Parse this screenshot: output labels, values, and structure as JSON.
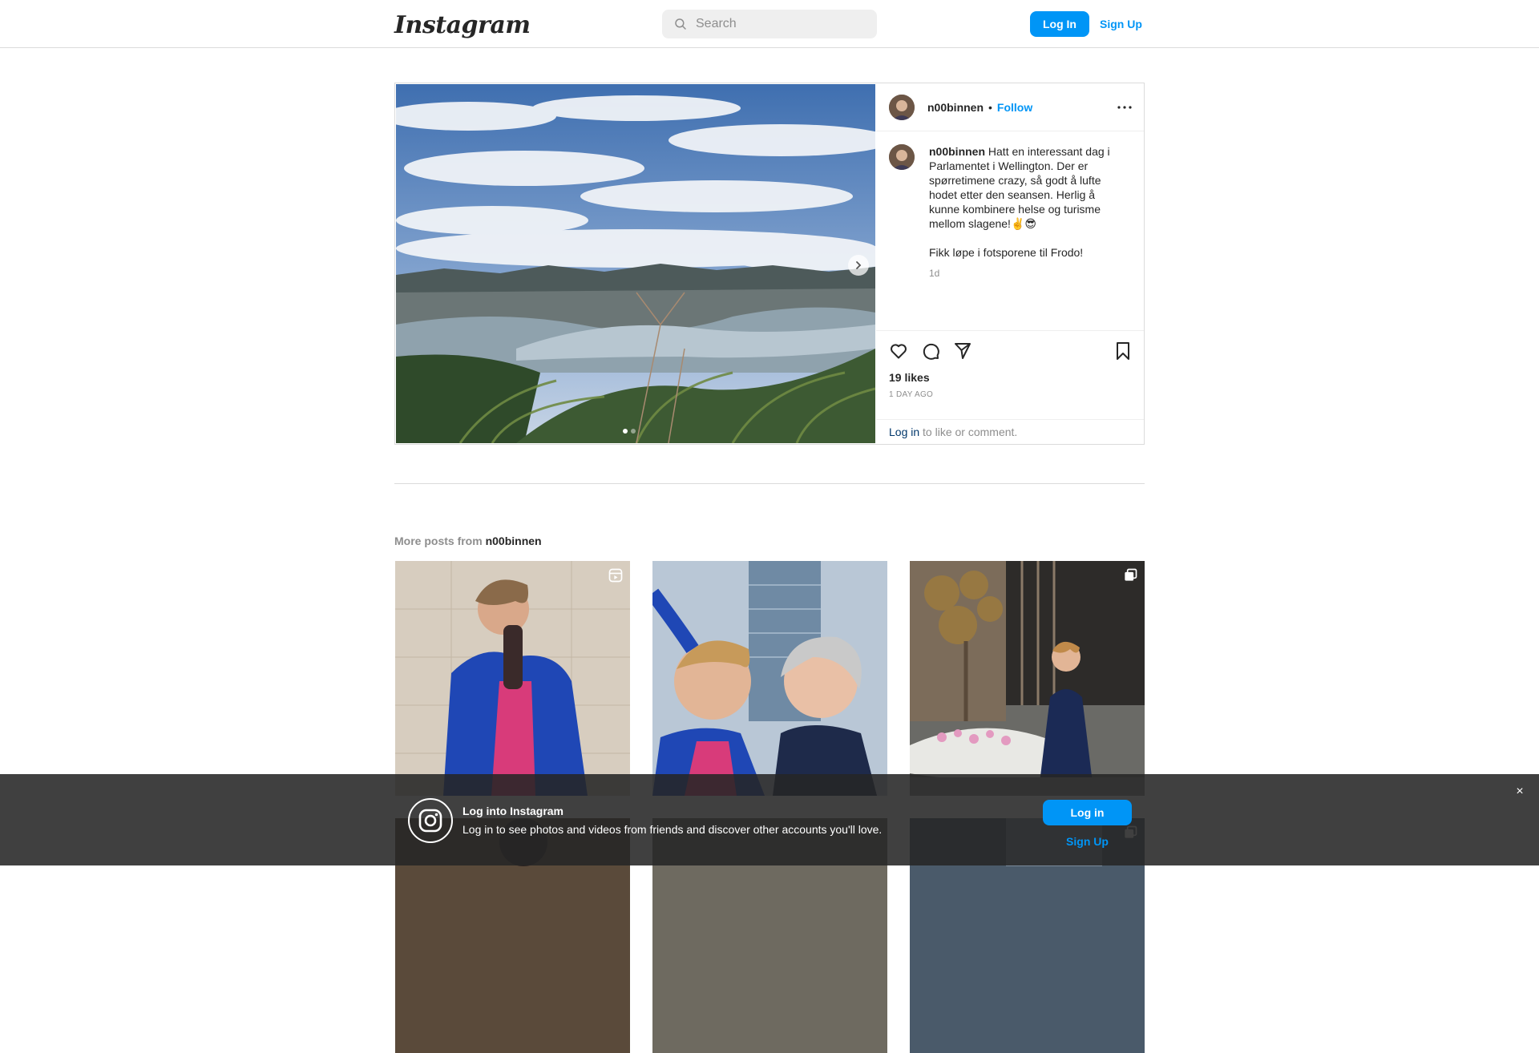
{
  "nav": {
    "logo": "Instagram",
    "search_placeholder": "Search",
    "login_label": "Log In",
    "signup_label": "Sign Up"
  },
  "post": {
    "username": "n00binnen",
    "separator": "•",
    "follow_label": "Follow",
    "caption_username": "n00binnen",
    "caption_text": "Hatt en interessant dag i Parlamentet i Wellington. Der er spørretimene crazy, så godt å lufte hodet etter den seansen. Herlig å kunne kombinere helse og turisme mellom slagene!✌️😎",
    "caption_text_2": "Fikk løpe i fotsporene til Frodo!",
    "caption_time": "1d",
    "likes": "19 likes",
    "posted_ago": "1 day ago",
    "login_link": "Log in",
    "login_suffix": " to like or comment.",
    "carousel_total": 2,
    "carousel_active": 1
  },
  "more_posts": {
    "prefix": "More posts from ",
    "username": "n00binnen"
  },
  "banner": {
    "title": "Log into Instagram",
    "text": "Log in to see photos and videos from friends and discover other accounts you'll love.",
    "login_label": "Log in",
    "signup_label": "Sign Up",
    "close_glyph": "×"
  },
  "colors": {
    "accent": "#0095f6",
    "link_dark": "#00376b",
    "muted": "#8e8e8e",
    "border": "#dbdbdb"
  },
  "icons": [
    "search-icon",
    "chevron-right-icon",
    "more-icon",
    "heart-icon",
    "comment-icon",
    "share-icon",
    "bookmark-icon",
    "reel-icon",
    "carousel-icon",
    "instagram-logo-icon",
    "close-icon"
  ]
}
